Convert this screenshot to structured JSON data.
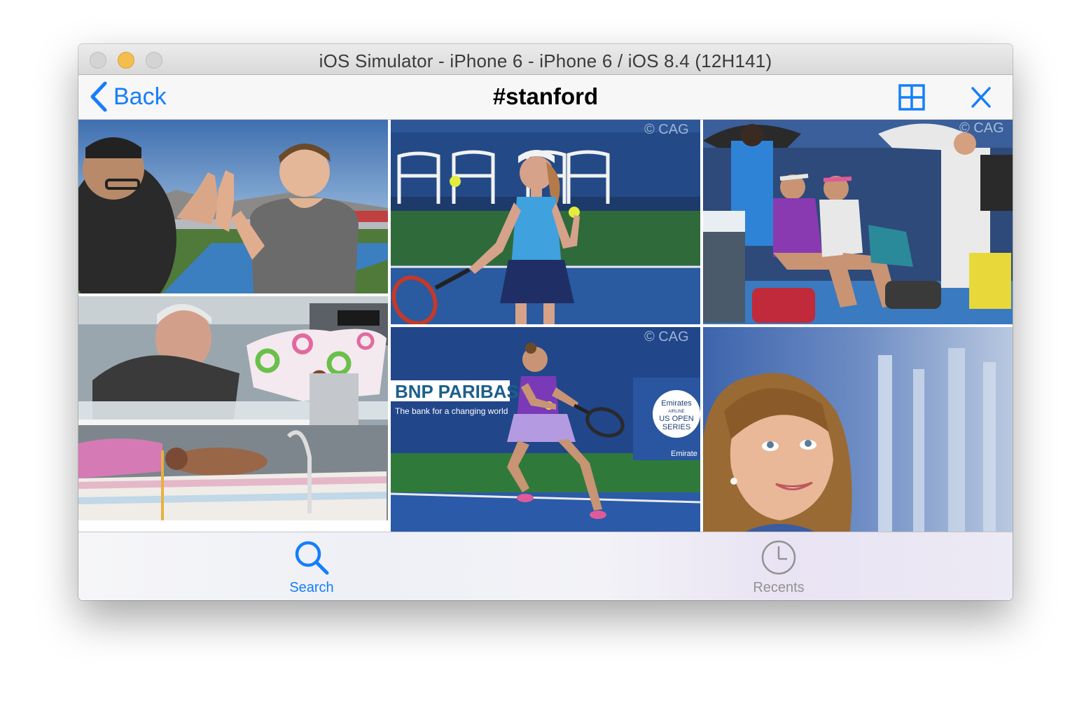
{
  "window": {
    "title": "iOS Simulator - iPhone 6 - iPhone 6 / iOS 8.4 (12H141)"
  },
  "navbar": {
    "back_label": "Back",
    "title": "#stanford"
  },
  "tabbar": {
    "items": [
      {
        "label": "Search",
        "icon": "search-icon",
        "selected": true
      },
      {
        "label": "Recents",
        "icon": "clock-icon",
        "selected": false
      }
    ]
  },
  "photos": [
    {
      "subject": "high-five on football field"
    },
    {
      "subject": "tennis player in blue dress"
    },
    {
      "subject": "tennis players seated courtside"
    },
    {
      "subject": "doctor with baby in incubator"
    },
    {
      "subject": "tennis player in purple hitting backhand"
    },
    {
      "subject": "woman looking upward"
    }
  ],
  "photo_text": {
    "watermark": "© CAG",
    "sponsor_main": "BNP PARIBAS",
    "sponsor_sub": "The bank for a changing world",
    "emirates": "Emirates",
    "airline": "AIRLINE",
    "us_open": "US OPEN",
    "series": "SERIES",
    "emirates_small": "Emirate"
  },
  "colors": {
    "accent": "#157efb",
    "tab_inactive": "#929292",
    "minimize": "#f4be4f"
  }
}
